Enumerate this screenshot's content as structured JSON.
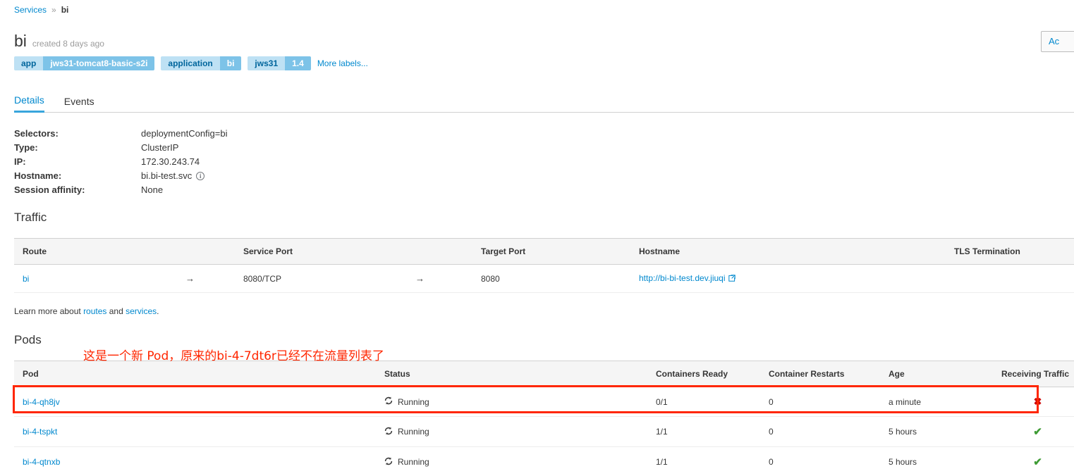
{
  "breadcrumb": {
    "root_label": "Services",
    "separator": "»",
    "current_label": "bi"
  },
  "header": {
    "title": "bi",
    "created": "created 8 days ago",
    "actions_label": "Ac",
    "more_labels": "More labels..."
  },
  "labels": [
    {
      "key": "app",
      "value": "jws31-tomcat8-basic-s2i"
    },
    {
      "key": "application",
      "value": "bi"
    },
    {
      "key": "jws31",
      "value": "1.4"
    }
  ],
  "tabs": [
    {
      "label": "Details",
      "active": true
    },
    {
      "label": "Events",
      "active": false
    }
  ],
  "details": [
    {
      "term": "Selectors:",
      "value": "deploymentConfig=bi"
    },
    {
      "term": "Type:",
      "value": "ClusterIP"
    },
    {
      "term": "IP:",
      "value": "172.30.243.74"
    },
    {
      "term": "Hostname:",
      "value": "bi.bi-test.svc"
    },
    {
      "term": "Session affinity:",
      "value": "None"
    }
  ],
  "traffic": {
    "heading": "Traffic",
    "columns": [
      "Route",
      "",
      "Service Port",
      "",
      "Target Port",
      "Hostname",
      "TLS Termination"
    ],
    "rows": [
      {
        "route": "bi",
        "arrow1": "→",
        "service_port": "8080/TCP",
        "arrow2": "→",
        "target_port": "8080",
        "hostname": "http://bi-bi-test.dev.jiuqi",
        "tls": ""
      }
    ]
  },
  "learn_more": {
    "prefix": "Learn more about ",
    "link1": "routes",
    "middle": " and ",
    "link2": "services",
    "suffix": "."
  },
  "pods": {
    "heading": "Pods",
    "annotation": "这是一个新 Pod，原来的bi-4-7dt6r已经不在流量列表了",
    "columns": [
      "Pod",
      "Status",
      "Containers Ready",
      "Container Restarts",
      "Age",
      "Receiving Traffic"
    ],
    "rows": [
      {
        "pod": "bi-4-qh8jv",
        "status": "Running",
        "containers_ready": "0/1",
        "container_restarts": "0",
        "age": "a minute",
        "receiving_traffic": "✖",
        "receiving_ok": false,
        "highlighted": true
      },
      {
        "pod": "bi-4-tspkt",
        "status": "Running",
        "containers_ready": "1/1",
        "container_restarts": "0",
        "age": "5 hours",
        "receiving_traffic": "✔",
        "receiving_ok": true,
        "highlighted": false
      },
      {
        "pod": "bi-4-qtnxb",
        "status": "Running",
        "containers_ready": "1/1",
        "container_restarts": "0",
        "age": "5 hours",
        "receiving_traffic": "✔",
        "receiving_ok": true,
        "highlighted": false
      }
    ]
  },
  "colors": {
    "link": "#0088ce",
    "label_key_bg": "#bee1f4",
    "label_value_bg": "#7dc3e8",
    "annotation": "#ff2600",
    "ok": "#3f9c35",
    "bad": "#cc0000"
  }
}
